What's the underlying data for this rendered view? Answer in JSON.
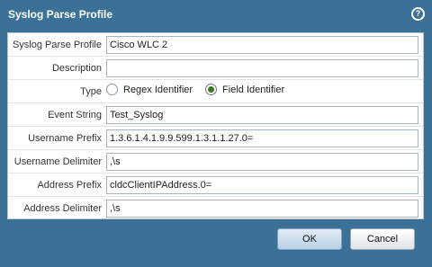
{
  "dialog": {
    "title": "Syslog Parse Profile",
    "help_icon": "question-mark-icon"
  },
  "fields": {
    "profile_label": "Syslog Parse Profile",
    "profile_value": "Cisco WLC 2",
    "description_label": "Description",
    "description_value": "",
    "type_label": "Type",
    "type_options": [
      {
        "label": "Regex Identifier",
        "selected": false
      },
      {
        "label": "Field Identifier",
        "selected": true
      }
    ],
    "event_string_label": "Event String",
    "event_string_value": "Test_Syslog",
    "username_prefix_label": "Username Prefix",
    "username_prefix_value": "1.3.6.1.4.1.9.9.599.1.3.1.1.27.0=",
    "username_delimiter_label": "Username Delimiter",
    "username_delimiter_value": ",\\s",
    "address_prefix_label": "Address Prefix",
    "address_prefix_value": "cldcClientIPAddress.0=",
    "address_delimiter_label": "Address Delimiter",
    "address_delimiter_value": ",\\s"
  },
  "buttons": {
    "ok_label": "OK",
    "cancel_label": "Cancel"
  },
  "colors": {
    "dialog_bg": "#3c7197",
    "radio_selected": "#3b7a1e"
  }
}
